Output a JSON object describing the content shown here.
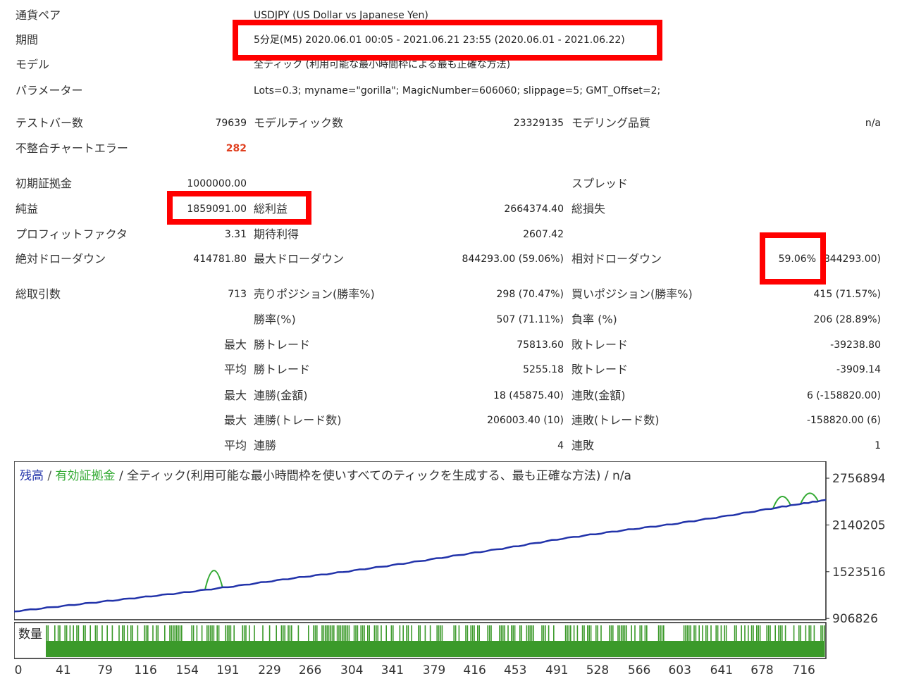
{
  "rows": [
    {
      "label": "通貨ペア",
      "value": "USDJPY (US Dollar vs Japanese Yen)"
    },
    {
      "label": "期間",
      "value": "5分足(M5) 2020.06.01 00:05 - 2021.06.21 23:55 (2020.06.01 - 2021.06.22)"
    },
    {
      "label": "モデル",
      "value": "全ティック (利用可能な最小時間枠による最も正確な方法)"
    },
    {
      "label": "パラメーター",
      "value": "Lots=0.3; myname=\"gorilla\"; MagicNumber=606060; slippage=5; GMT_Offset=2;"
    }
  ],
  "stats": {
    "test_bars": {
      "label": "テストバー数",
      "value": "79639"
    },
    "model_ticks": {
      "label": "モデルティック数",
      "value": "23329135"
    },
    "model_quality": {
      "label": "モデリング品質",
      "value": "n/a"
    },
    "mismatch": {
      "label": "不整合チャートエラー",
      "value": "282"
    },
    "initial_deposit": {
      "label": "初期証拠金",
      "value": "1000000.00"
    },
    "spread": {
      "label": "スプレッド",
      "value": ""
    },
    "net_profit": {
      "label": "純益",
      "value": "1859091.00"
    },
    "gross_profit": {
      "label": "総利益",
      "value": "2664374.40"
    },
    "gross_loss": {
      "label": "総損失",
      "value": ""
    },
    "profit_factor": {
      "label": "プロフィットファクタ",
      "value": "3.31"
    },
    "expected_payoff": {
      "label": "期待利得",
      "value": "2607.42"
    },
    "abs_dd": {
      "label": "絶対ドローダウン",
      "value": "414781.80"
    },
    "max_dd": {
      "label": "最大ドローダウン",
      "value": "844293.00 (59.06%)"
    },
    "rel_dd": {
      "label": "相対ドローダウン",
      "value_pct": "59.06%",
      "value_rest": "844293.00)"
    },
    "total_trades": {
      "label": "総取引数",
      "value": "713"
    },
    "short_pos": {
      "label": "売りポジション(勝率%)",
      "value": "298 (70.47%)"
    },
    "long_pos": {
      "label": "買いポジション(勝率%)",
      "value": "415 (71.57%)"
    },
    "win_rate": {
      "label": "勝率(%)",
      "value": "507 (71.11%)"
    },
    "loss_rate": {
      "label": "負率 (%)",
      "value": "206 (28.89%)"
    },
    "largest_prefix": "最大",
    "average_prefix": "平均",
    "largest_win": {
      "label": "勝トレード",
      "value": "75813.60"
    },
    "largest_loss": {
      "label": "敗トレード",
      "value": "-39238.80"
    },
    "avg_win": {
      "label": "勝トレード",
      "value": "5255.18"
    },
    "avg_loss": {
      "label": "敗トレード",
      "value": "-3909.14"
    },
    "max_cons_wins_money": {
      "label": "連勝(金額)",
      "value": "18 (45875.40)"
    },
    "max_cons_losses_money": {
      "label": "連敗(金額)",
      "value": "6 (-158820.00)"
    },
    "max_cons_wins_count": {
      "label": "連勝(トレード数)",
      "value": "206003.40 (10)"
    },
    "max_cons_losses_count": {
      "label": "連敗(トレード数)",
      "value": "-158820.00 (6)"
    },
    "avg_cons_wins": {
      "label": "連勝",
      "value": "4"
    },
    "avg_cons_losses": {
      "label": "連敗",
      "value": "1"
    }
  },
  "colors": {
    "balance": "#2233aa",
    "equity": "#33aa33",
    "highlight": "#ff0000",
    "bars": "#3b9a2a",
    "mismatch": "#e04020"
  },
  "chart_data": {
    "type": "line",
    "title_balance": "残高",
    "title_sep1": " / ",
    "title_equity": "有効証拠金",
    "title_rest": " / 全ティック(利用可能な最小時間枠を使いすべてのティックを生成する、最も正確な方法) / n/a",
    "volume_label": "数量",
    "y_ticks": [
      906826,
      1523516,
      2140205,
      2756894
    ],
    "ylim": [
      890000,
      2980000
    ],
    "xlim": [
      0,
      740
    ],
    "x_ticks": [
      0,
      41,
      79,
      116,
      154,
      191,
      229,
      266,
      304,
      341,
      379,
      416,
      453,
      491,
      528,
      566,
      603,
      641,
      678,
      716
    ],
    "balance": [
      [
        0,
        1000000
      ],
      [
        50,
        1080000
      ],
      [
        100,
        1160000
      ],
      [
        150,
        1240000
      ],
      [
        200,
        1330000
      ],
      [
        250,
        1430000
      ],
      [
        300,
        1520000
      ],
      [
        350,
        1620000
      ],
      [
        400,
        1730000
      ],
      [
        450,
        1840000
      ],
      [
        500,
        1960000
      ],
      [
        550,
        2060000
      ],
      [
        600,
        2150000
      ],
      [
        650,
        2260000
      ],
      [
        700,
        2380000
      ],
      [
        740,
        2470000
      ]
    ],
    "equity_spikes": [
      [
        182,
        1780000
      ],
      [
        700,
        2650000
      ],
      [
        725,
        2680000
      ]
    ]
  }
}
